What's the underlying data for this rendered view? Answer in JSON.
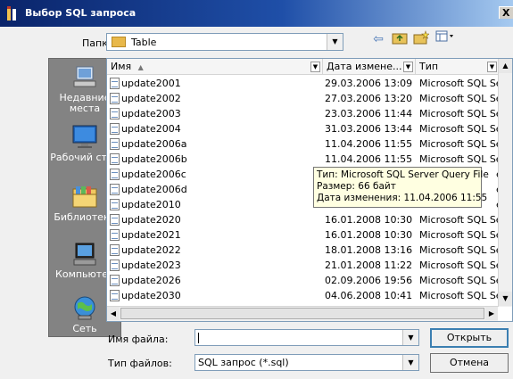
{
  "window": {
    "title": "Выбор SQL запроса",
    "close": "X"
  },
  "toolbar": {
    "lookin_label": "Папка:",
    "lookin_value": "Table"
  },
  "places": [
    {
      "label": "Недавние места",
      "icon": "recent-places-icon"
    },
    {
      "label": "Рабочий стол",
      "icon": "desktop-icon"
    },
    {
      "label": "Библиотеки",
      "icon": "libraries-icon"
    },
    {
      "label": "Компьютер",
      "icon": "computer-icon"
    },
    {
      "label": "Сеть",
      "icon": "network-icon"
    }
  ],
  "columns": {
    "name": "Имя",
    "date": "Дата измене...",
    "type": "Тип"
  },
  "files": [
    {
      "name": "update2001",
      "date": "29.03.2006 13:09",
      "type": "Microsoft SQL Se..."
    },
    {
      "name": "update2002",
      "date": "27.03.2006 13:20",
      "type": "Microsoft SQL Se..."
    },
    {
      "name": "update2003",
      "date": "23.03.2006 11:44",
      "type": "Microsoft SQL Se..."
    },
    {
      "name": "update2004",
      "date": "31.03.2006 13:44",
      "type": "Microsoft SQL Se..."
    },
    {
      "name": "update2006a",
      "date": "11.04.2006 11:55",
      "type": "Microsoft SQL Se..."
    },
    {
      "name": "update2006b",
      "date": "11.04.2006 11:55",
      "type": "Microsoft SQL Se..."
    },
    {
      "name": "update2006c",
      "date": "",
      "type": "e..."
    },
    {
      "name": "update2006d",
      "date": "",
      "type": "e..."
    },
    {
      "name": "update2010",
      "date": "",
      "type": "e..."
    },
    {
      "name": "update2020",
      "date": "16.01.2008 10:30",
      "type": "Microsoft SQL Se..."
    },
    {
      "name": "update2021",
      "date": "16.01.2008 10:30",
      "type": "Microsoft SQL Se..."
    },
    {
      "name": "update2022",
      "date": "18.01.2008 13:16",
      "type": "Microsoft SQL Se..."
    },
    {
      "name": "update2023",
      "date": "21.01.2008 11:22",
      "type": "Microsoft SQL Se..."
    },
    {
      "name": "update2026",
      "date": "02.09.2006 19:56",
      "type": "Microsoft SQL Se..."
    },
    {
      "name": "update2030",
      "date": "04.06.2008 10:41",
      "type": "Microsoft SQL Se..."
    }
  ],
  "tooltip": {
    "line1": "Тип: Microsoft SQL Server Query File",
    "line2": "Размер: 66 байт",
    "line3": "Дата изменения: 11.04.2006 11:55"
  },
  "form": {
    "filename_label": "Имя файла:",
    "filename_value": "",
    "filetype_label": "Тип файлов:",
    "filetype_value": "SQL запрос (*.sql)",
    "open_label": "Открыть",
    "cancel_label": "Отмена"
  }
}
